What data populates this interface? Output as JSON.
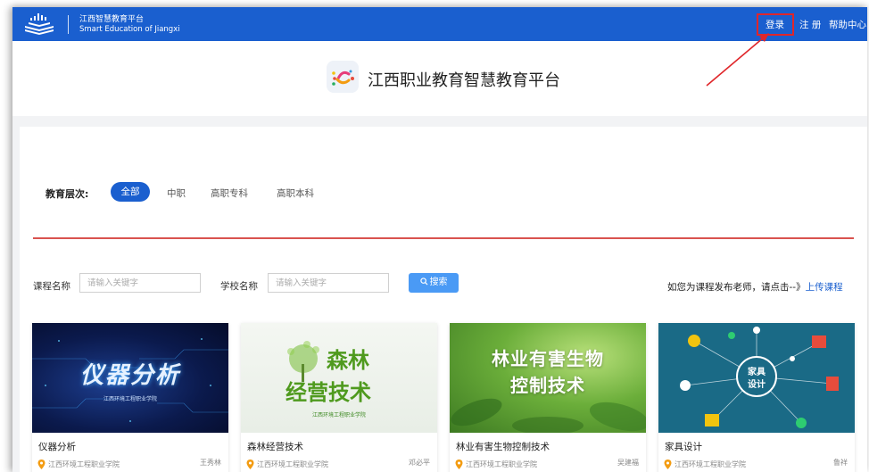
{
  "topbar": {
    "brand_cn": "江西智慧教育平台",
    "brand_en": "Smart Education of Jiangxi",
    "login": "登录",
    "register": "注 册",
    "help": "帮助中心"
  },
  "header": {
    "title": "江西职业教育智慧教育平台"
  },
  "filter": {
    "label": "教育层次:",
    "options": [
      "全部",
      "中职",
      "高职专科",
      "高职本科"
    ],
    "selected": "全部"
  },
  "search": {
    "course_label": "课程名称",
    "course_placeholder": "请输入关键字",
    "school_label": "学校名称",
    "school_placeholder": "请输入关键字",
    "button": "搜索",
    "upload_hint": "如您为课程发布老师，请点击--》",
    "upload_link": "上传课程"
  },
  "courses": [
    {
      "title": "仪器分析",
      "school": "江西环境工程职业学院",
      "teacher": "王秀林",
      "thumb_text": "仪器分析",
      "thumb_sub": "江西环境工程职业学院"
    },
    {
      "title": "森林经营技术",
      "school": "江西环境工程职业学院",
      "teacher": "邓必平",
      "thumb_text_1": "森林",
      "thumb_text_2": "经营技术",
      "thumb_sub": "江西环境工程职业学院"
    },
    {
      "title": "林业有害生物控制技术",
      "school": "江西环境工程职业学院",
      "teacher": "吴建福",
      "thumb_text_1": "林业有害生物",
      "thumb_text_2": "控制技术"
    },
    {
      "title": "家具设计",
      "school": "江西环境工程职业学院",
      "teacher": "鲁祥",
      "thumb_text_1": "家具",
      "thumb_text_2": "设计"
    }
  ],
  "colors": {
    "topbar": "#1a5fcf",
    "accent": "#1a5fcf",
    "highlight": "#e0262a",
    "search_button": "#4a9af5"
  },
  "icons": {
    "logo": "books-logo-icon",
    "platform_logo": "platform-logo-icon",
    "search": "search-icon",
    "location": "location-pin-icon"
  }
}
